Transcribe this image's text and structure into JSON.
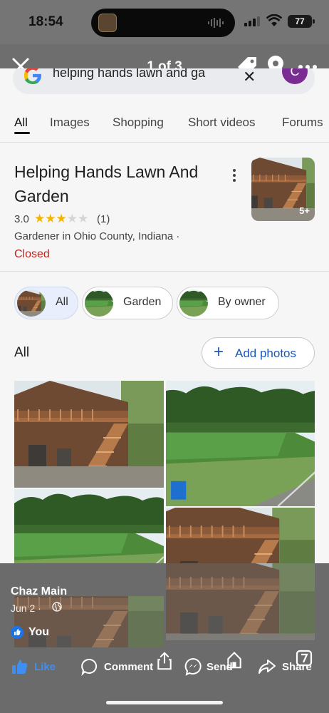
{
  "status_bar": {
    "time": "18:54",
    "battery": "77"
  },
  "viewer": {
    "counter": "1 of 3"
  },
  "screenshot": {
    "search": {
      "query": "helping hands lawn and ga",
      "avatar_initial": "C"
    },
    "tabs": [
      "All",
      "Images",
      "Shopping",
      "Short videos",
      "Forums"
    ],
    "business": {
      "name": "Helping Hands Lawn And Garden",
      "rating": "3.0",
      "stars_filled": 3,
      "stars_total": 5,
      "review_count": "(1)",
      "category": "Gardener in Ohio County, Indiana ·",
      "status": "Closed",
      "photo_count": "5+"
    },
    "filter_chips": [
      "All",
      "Garden",
      "By owner"
    ],
    "photos_section": {
      "heading": "All",
      "add_button": "Add photos"
    }
  },
  "post": {
    "author": "Chaz Main",
    "date": "Jun 2 ·",
    "reaction": "You",
    "actions": {
      "like": "Like",
      "comment": "Comment",
      "send": "Send",
      "share": "Share"
    }
  },
  "colors": {
    "closed": "#c5221f",
    "link_blue": "#1a56b8",
    "facebook_blue": "#1b74e4",
    "overlay_gray": "#6b6b6b"
  }
}
